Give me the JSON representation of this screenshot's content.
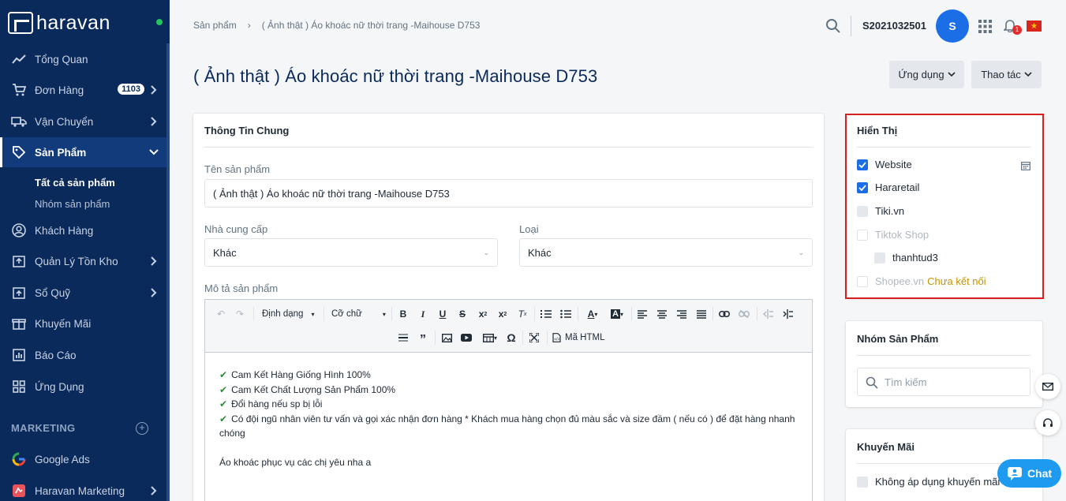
{
  "sidebar": {
    "logo": "haravan",
    "nav": [
      {
        "label": "Tổng Quan"
      },
      {
        "label": "Đơn Hàng",
        "badge": "1103"
      },
      {
        "label": "Vận Chuyển"
      },
      {
        "label": "Sản Phẩm"
      },
      {
        "label": "Khách Hàng"
      },
      {
        "label": "Quản Lý Tồn Kho"
      },
      {
        "label": "Sổ Quỹ"
      },
      {
        "label": "Khuyến Mãi"
      },
      {
        "label": "Báo Cáo"
      },
      {
        "label": "Ứng Dụng"
      },
      {
        "label": "Google Ads"
      },
      {
        "label": "Haravan Marketing"
      }
    ],
    "sub": [
      "Tất cả sản phẩm",
      "Nhóm sản phẩm"
    ],
    "section": "MARKETING"
  },
  "header": {
    "breadcrumb": [
      "Sản phẩm",
      "( Ảnh thật ) Áo khoác nữ thời trang -Maihouse D753"
    ],
    "shop": "S2021032501",
    "avatar": "S",
    "notif_count": "1"
  },
  "page": {
    "title": "( Ảnh thật ) Áo khoác nữ thời trang -Maihouse D753",
    "btn_apps": "Ứng dụng",
    "btn_actions": "Thao tác"
  },
  "general": {
    "title": "Thông Tin Chung",
    "name_label": "Tên sản phẩm",
    "name_value": "( Ảnh thật ) Áo khoác nữ thời trang -Maihouse  D753",
    "vendor_label": "Nhà cung cấp",
    "vendor_value": "Khác",
    "type_label": "Loại",
    "type_value": "Khác",
    "desc_label": "Mô tả sản phẩm"
  },
  "editor": {
    "format": "Định dạng",
    "size": "Cỡ chữ",
    "html": "Mã HTML",
    "lines": [
      "Cam Kết Hàng Giống Hình 100%",
      "Cam Kết Chất Lượng Sản Phẩm 100%",
      "Đổi hàng nếu sp bị lỗi",
      "Có đội ngũ nhân viên tư vấn và gọi xác nhận đơn hàng * Khách mua hàng chọn đủ màu sắc và size đầm ( nếu có ) để đặt hàng nhanh chóng"
    ],
    "footer_line": "Áo khoác phục vụ các chị yêu nha a"
  },
  "display": {
    "title": "Hiển Thị",
    "channels": [
      {
        "label": "Website",
        "state": "on"
      },
      {
        "label": "Hararetail",
        "state": "on"
      },
      {
        "label": "Tiki.vn",
        "state": "off"
      },
      {
        "label": "Tiktok Shop",
        "state": "disabled"
      },
      {
        "label": "thanhtud3",
        "state": "off"
      },
      {
        "label": "Shopee.vn",
        "state": "disabled",
        "note": "Chưa kết nối"
      }
    ]
  },
  "groups": {
    "title": "Nhóm Sản Phẩm",
    "search_placeholder": "Tìm kiếm"
  },
  "promo": {
    "title": "Khuyến Mãi",
    "option": "Không áp dụng khuyến mãi"
  },
  "chat": "Chat",
  "colors": {
    "sidebar": "#0a2a5c",
    "accent": "#1c6ee6",
    "highlight": "#d81f1f",
    "warn": "#c69300"
  }
}
